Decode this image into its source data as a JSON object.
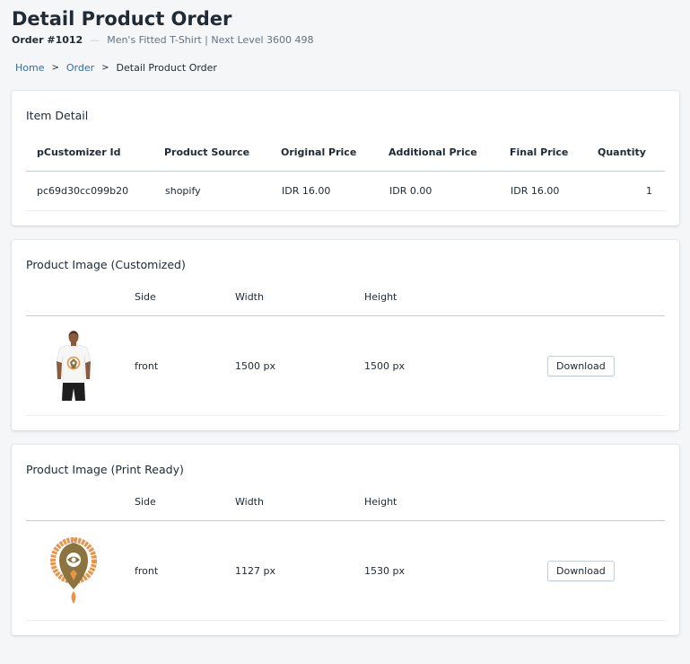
{
  "header": {
    "title": "Detail Product Order",
    "order_number": "Order #1012",
    "separator": "—",
    "product_name": "Men's Fitted T-Shirt | Next Level 3600 498"
  },
  "breadcrumb": {
    "home": "Home",
    "order": "Order",
    "current": "Detail Product Order",
    "sep": ">"
  },
  "item_detail": {
    "title": "Item Detail",
    "columns": [
      "pCustomizer Id",
      "Product Source",
      "Original Price",
      "Additional Price",
      "Final Price",
      "Quantity"
    ],
    "row": {
      "id": "pc69d30cc099b20",
      "source": "shopify",
      "original_price": "IDR 16.00",
      "additional_price": "IDR 0.00",
      "final_price": "IDR 16.00",
      "quantity": "1"
    }
  },
  "image_customized": {
    "title": "Product Image (Customized)",
    "columns": [
      "Side",
      "Width",
      "Height"
    ],
    "row": {
      "side": "front",
      "width": "1500 px",
      "height": "1500 px",
      "download_label": "Download"
    }
  },
  "image_print_ready": {
    "title": "Product Image (Print Ready)",
    "columns": [
      "Side",
      "Width",
      "Height"
    ],
    "row": {
      "side": "front",
      "width": "1127 px",
      "height": "1530 px",
      "download_label": "Download"
    }
  },
  "colors": {
    "link": "#2e6fa8",
    "background": "#f4f6f8",
    "design_orange": "#e8944a",
    "design_olive": "#8b7440"
  }
}
